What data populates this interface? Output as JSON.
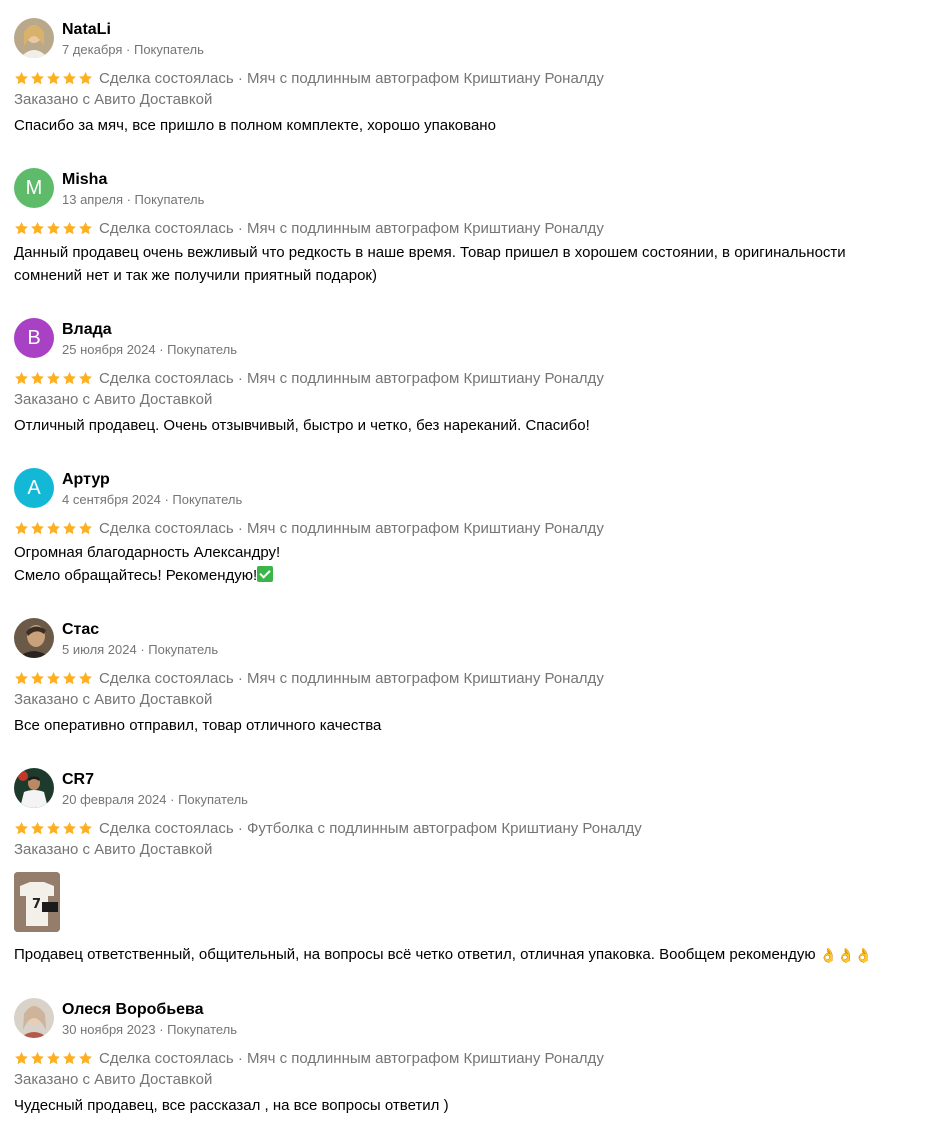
{
  "rating_color": "#ffb021",
  "stars_per_review": 5,
  "reviews": [
    {
      "name": "NataLi",
      "date": "7 декабря",
      "role": "Покупатель",
      "meta": "7 декабря · Покупатель",
      "rating": 5,
      "deal": "Сделка состоялась · Мяч с подлинным автографом Криштиану Роналду",
      "delivery": "Заказано с Авито Доставкой",
      "text": "Спасибо за мяч, все пришло в полном комплекте, хорошо упаковано",
      "avatar": {
        "type": "photo",
        "icon": "woman-photo-avatar"
      }
    },
    {
      "name": "Misha",
      "meta": "13 апреля · Покупатель",
      "rating": 5,
      "deal": "Сделка состоялась · Мяч с подлинным автографом Криштиану Роналду",
      "text_lines": [
        "Данный продавец очень вежливый что редкость в наше время. Товар пришел в хорошем состоянии, в оригинальности",
        "сомнений нет и так же получили приятный подарок)"
      ],
      "avatar": {
        "type": "letter",
        "letter": "M",
        "color": "#5dbb6a"
      }
    },
    {
      "name": "Влада",
      "meta": "25 ноября 2024 · Покупатель",
      "rating": 5,
      "deal": "Сделка состоялась · Мяч с подлинным автографом Криштиану Роналду",
      "delivery": "Заказано с Авито Доставкой",
      "text": "Отличный продавец. Очень отзывчивый, быстро и четко, без нареканий. Спасибо!",
      "avatar": {
        "type": "letter",
        "letter": "В",
        "color": "#a841c4"
      }
    },
    {
      "name": "Артур",
      "meta": "4 сентября 2024 · Покупатель",
      "rating": 5,
      "deal": "Сделка состоялась · Мяч с подлинным автографом Криштиану Роналду",
      "text_lines": [
        "Огромная благодарность Александру!",
        "Смело обращайтесь! Рекомендую!"
      ],
      "emoji": "check-mark-icon",
      "avatar": {
        "type": "letter",
        "letter": "А",
        "color": "#13b8d6"
      }
    },
    {
      "name": "Стас",
      "meta": "5 июля 2024 · Покупатель",
      "rating": 5,
      "deal": "Сделка состоялась · Мяч с подлинным автографом Криштиану Роналду",
      "delivery": "Заказано с Авито Доставкой",
      "text": "Все оперативно отправил, товар отличного качества",
      "avatar": {
        "type": "photo",
        "icon": "man-photo-avatar"
      }
    },
    {
      "name": "CR7",
      "meta": "20 февраля 2024 · Покупатель",
      "rating": 5,
      "deal": "Сделка состоялась · Футболка с подлинным автографом Криштиану Роналду",
      "delivery": "Заказано с Авито Доставкой",
      "photo": "jersey-photo",
      "text": "Продавец ответственный, общительный, на вопросы всё четко ответил, отличная упаковка. Вообщем рекомендую",
      "emoji_ok": "👌👌👌",
      "avatar": {
        "type": "photo",
        "icon": "footballer-photo-avatar"
      }
    },
    {
      "name": "Олеся Воробьева",
      "meta": "30 ноября 2023 · Покупатель",
      "rating": 5,
      "deal": "Сделка состоялась · Мяч с подлинным автографом Криштиану Роналду",
      "delivery": "Заказано с Авито Доставкой",
      "text": "Чудесный продавец, все рассказал , на все вопросы ответил )",
      "avatar": {
        "type": "photo",
        "icon": "woman-photo-avatar"
      }
    }
  ]
}
